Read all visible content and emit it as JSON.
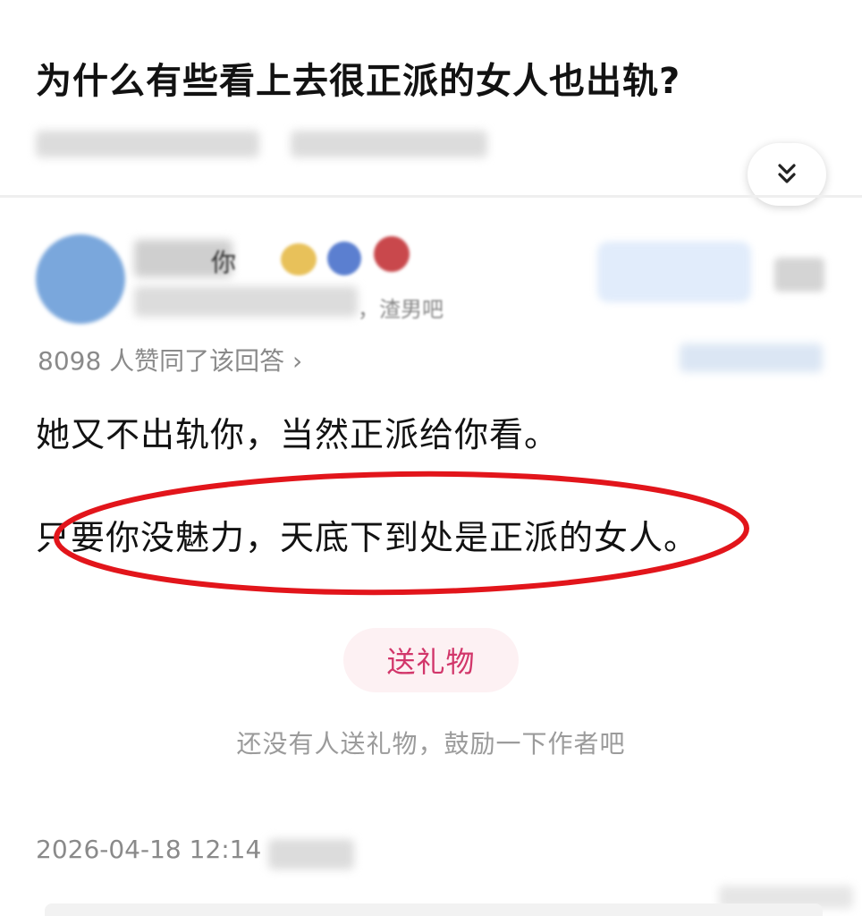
{
  "question": {
    "title": "为什么有些看上去很正派的女人也出轨?"
  },
  "header": {
    "expand_icon": "double-chevron-down-icon"
  },
  "author": {
    "name_fragment": "你",
    "sub_fragment": "，渣男吧",
    "avatar_color": "#7aa7dc"
  },
  "votes": {
    "text": "8098 人赞同了该回答 ›"
  },
  "answer": {
    "paragraphs": [
      "她又不出轨你，当然正派给你看。",
      "只要你没魅力，天底下到处是正派的女人。"
    ],
    "highlight_color": "#e2151b"
  },
  "gift": {
    "button_label": "送礼物",
    "hint": "还没有人送礼物，鼓励一下作者吧",
    "accent": "#d2366a"
  },
  "meta": {
    "timestamp": "2026-04-18 12:14"
  }
}
